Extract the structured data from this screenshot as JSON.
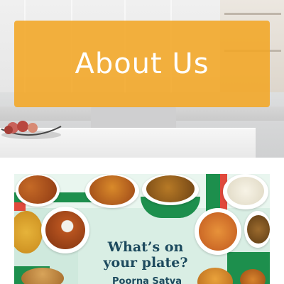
{
  "hero": {
    "title": "About Us",
    "banner_color": "#F3A624"
  },
  "collage": {
    "tagline_line1": "What’s on",
    "tagline_line2": "your plate?",
    "subline": "Poorna Satva",
    "accent_green": "#1D8F4D",
    "accent_red": "#E0493C",
    "text_color": "#1D4A5E"
  }
}
